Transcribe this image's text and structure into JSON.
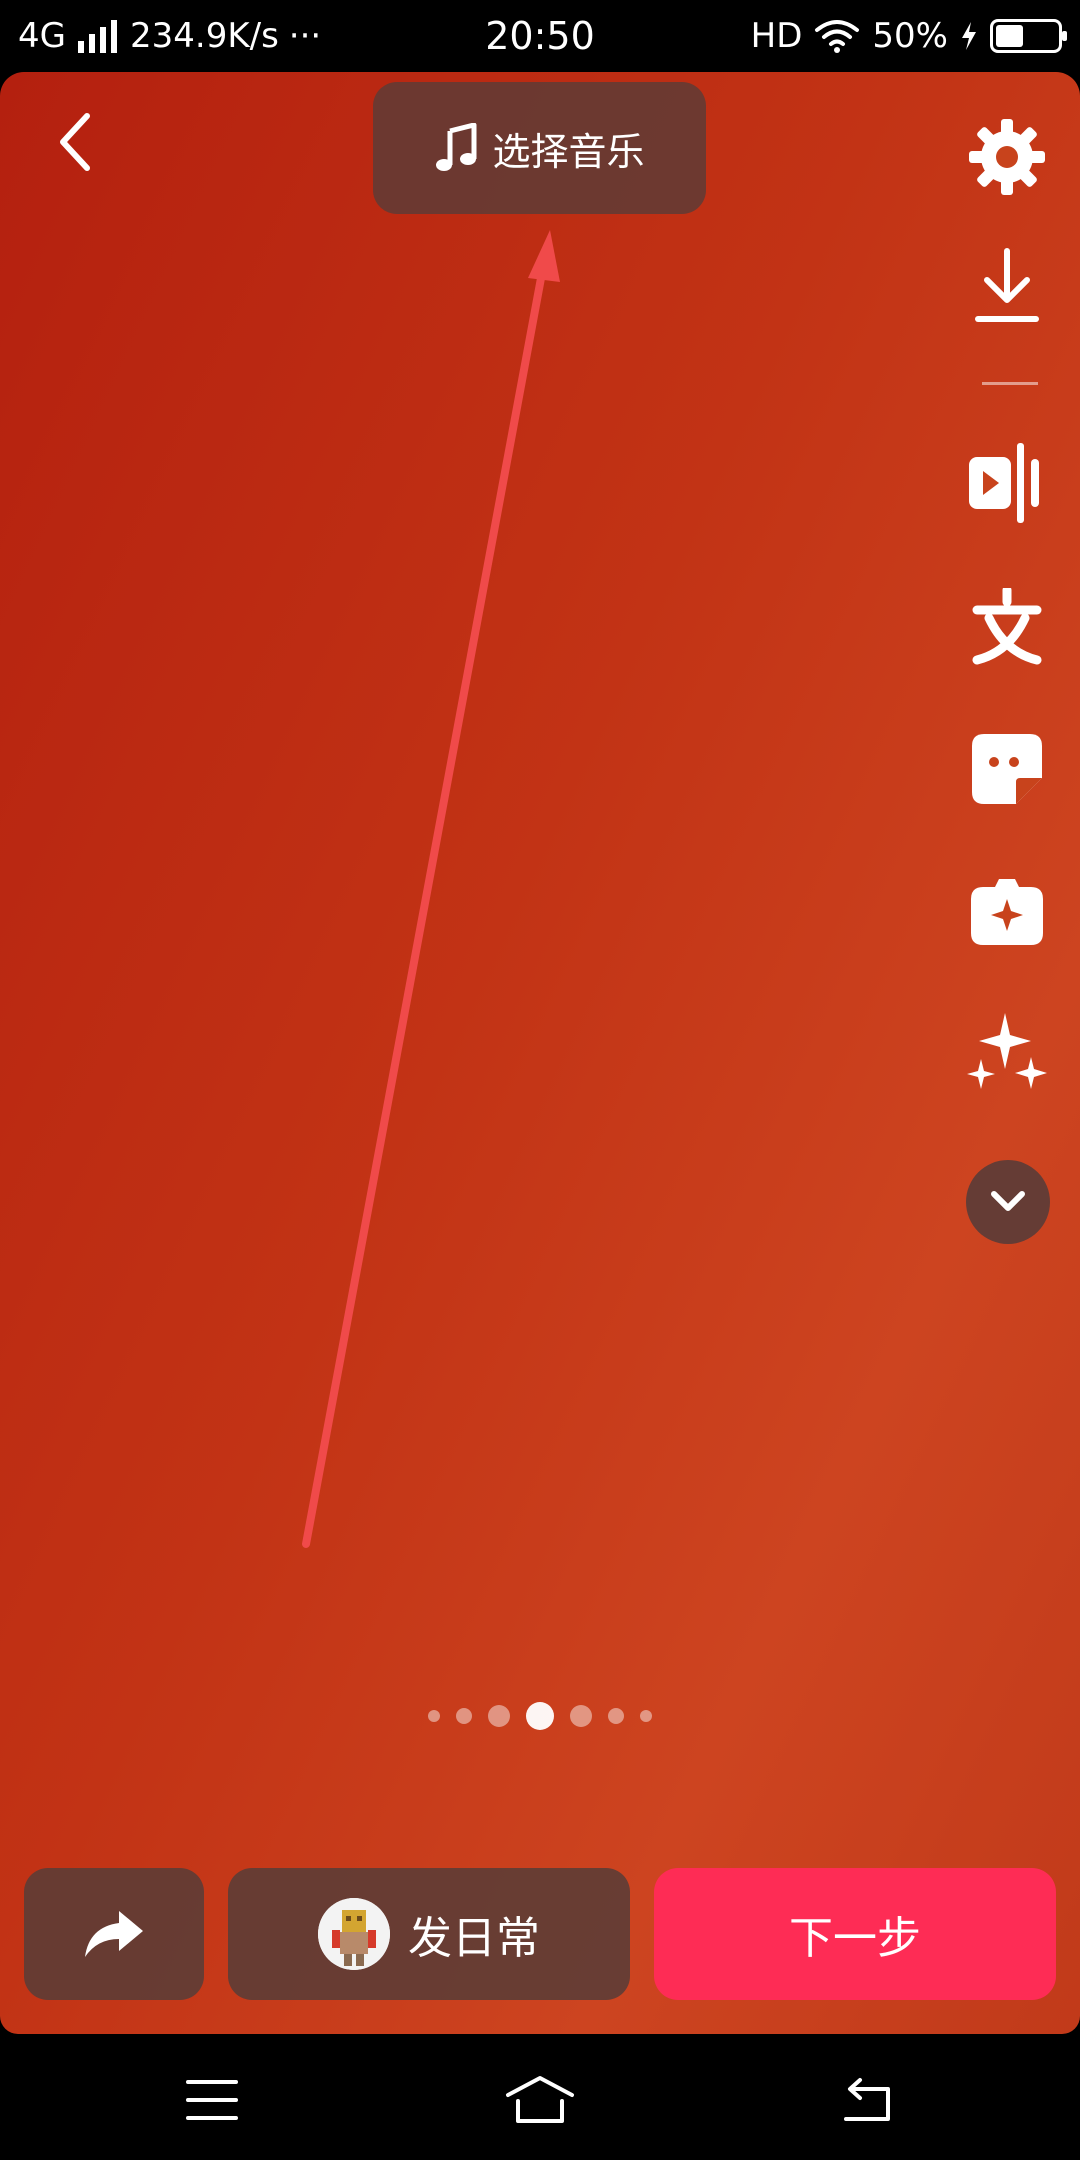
{
  "status_bar": {
    "network": "4G",
    "speed": "234.9K/s",
    "more": "···",
    "time": "20:50",
    "hd": "HD",
    "battery_text": "50%",
    "battery_level": 0.5
  },
  "editor": {
    "select_music_label": "选择音乐",
    "page_indicator": {
      "count": 7,
      "active_index": 3
    }
  },
  "bottom_bar": {
    "daily_label": "发日常",
    "next_label": "下一步"
  },
  "colors": {
    "accent": "#fe2c55",
    "annotation": "#f04a4a"
  }
}
